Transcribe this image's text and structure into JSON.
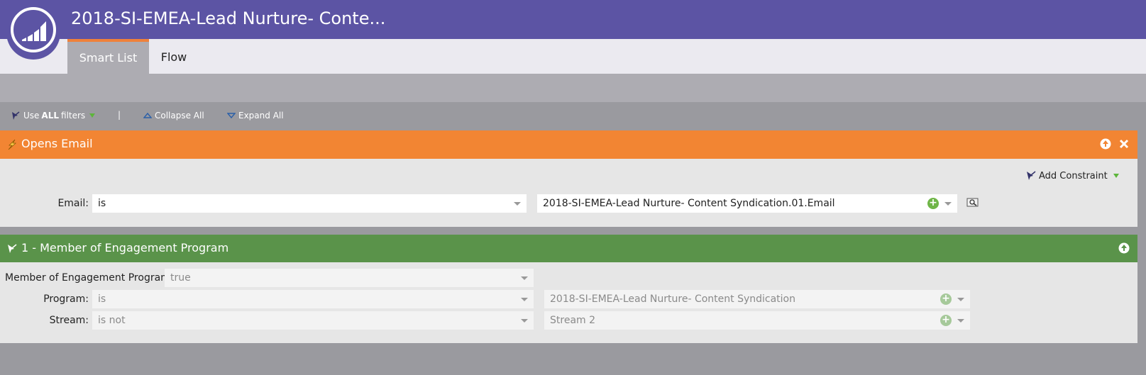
{
  "header": {
    "title": "2018-SI-EMEA-Lead Nurture- Conte...",
    "brand_color": "#5c54a4"
  },
  "tabs": [
    {
      "label": "Smart List",
      "active": true
    },
    {
      "label": "Flow",
      "active": false
    }
  ],
  "toolbar": {
    "use_prefix": "Use",
    "use_bold": "ALL",
    "use_suffix": "filters",
    "separator": "|",
    "collapse_all": "Collapse All",
    "expand_all": "Expand All"
  },
  "filters": [
    {
      "title": "Opens Email",
      "color": "#f28533",
      "add_constraint": "Add Constraint",
      "rows": [
        {
          "label": "Email:",
          "operator": "is",
          "value": "2018-SI-EMEA-Lead Nurture- Content Syndication.01.Email"
        }
      ]
    },
    {
      "title": "1 - Member of Engagement Program",
      "color": "#5a934a",
      "rows": [
        {
          "label": "Member of Engagement Program:",
          "operator": "true"
        },
        {
          "label": "Program:",
          "operator": "is",
          "value": "2018-SI-EMEA-Lead Nurture- Content Syndication"
        },
        {
          "label": "Stream:",
          "operator": "is not",
          "value": "Stream 2"
        }
      ]
    }
  ]
}
